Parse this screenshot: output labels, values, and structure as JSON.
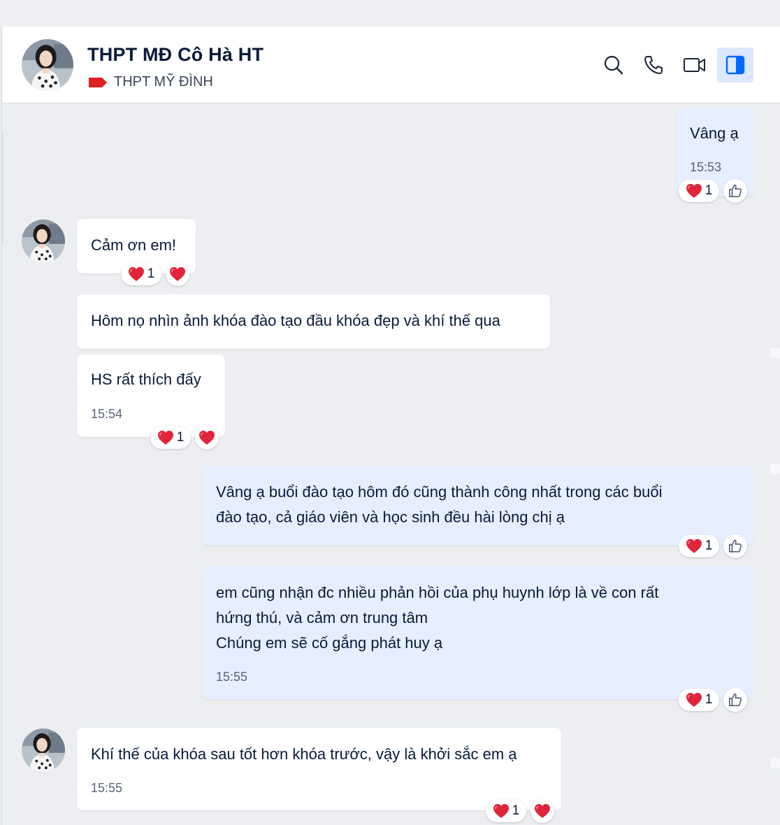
{
  "header": {
    "title": "THPT MĐ Cô Hà HT",
    "subtitle": "THPT MỸ ĐÌNH",
    "tag_color": "#e02020",
    "icons": [
      "search-icon",
      "phone-icon",
      "video-icon",
      "sidebar-panel-icon"
    ]
  },
  "messages": [
    {
      "side": "out",
      "text": "Vâng ạ",
      "time": "15:53",
      "reaction_count": "1"
    },
    {
      "side": "in",
      "text": "Cảm ơn em!",
      "reaction_count": "1"
    },
    {
      "side": "in",
      "text": "Hôm nọ nhìn ảnh khóa đào tạo đầu khóa đẹp và khí thế qua"
    },
    {
      "side": "in",
      "text": "HS rất thích đấy",
      "time": "15:54",
      "reaction_count": "1"
    },
    {
      "side": "out",
      "text": "Vâng ạ buổi đào tạo hôm đó cũng thành công nhất trong các buổi\nđào tạo, cả giáo viên và học sinh đều hài lòng chị ạ",
      "reaction_count": "1"
    },
    {
      "side": "out",
      "text": "em cũng nhận đc nhiều phản hồi của phụ huynh lớp là về con rất\nhứng thú, và cảm ơn trung tâm\nChúng em sẽ cố gắng phát huy ạ",
      "time": "15:55",
      "reaction_count": "1"
    },
    {
      "side": "in",
      "text": "Khí thế của khóa sau tốt hơn khóa trước, vậy là khởi sắc em ạ",
      "time": "15:55",
      "reaction_count": "1"
    }
  ],
  "colors": {
    "incoming_bubble": "#ffffff",
    "outgoing_bubble": "#e5efff",
    "heart": "#e0253a",
    "active_icon_bg": "#dbe8ff",
    "accent": "#0068ff"
  }
}
